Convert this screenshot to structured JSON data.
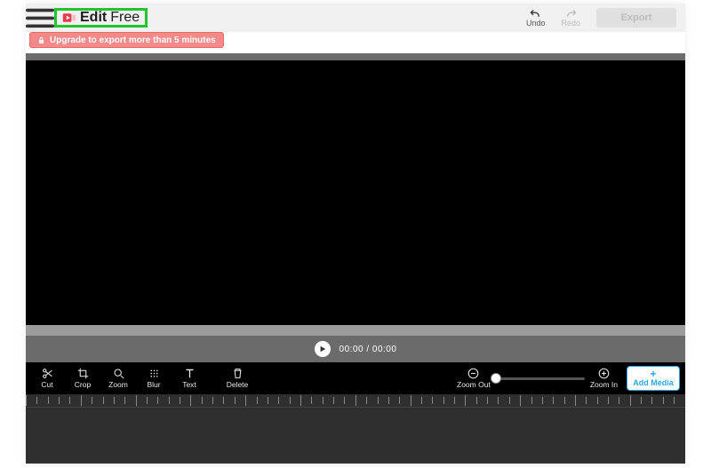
{
  "header": {
    "logo_a": "Edit",
    "logo_b": "Free",
    "undo_label": "Undo",
    "redo_label": "Redo",
    "export_label": "Export"
  },
  "banner": {
    "upgrade_text": "Upgrade to export more than 5 minutes"
  },
  "player": {
    "timecode": "00:00 / 00:00"
  },
  "tools": {
    "cut": "Cut",
    "crop": "Crop",
    "zoom": "Zoom",
    "blur": "Blur",
    "text": "Text",
    "delete": "Delete"
  },
  "zoom": {
    "out_label": "Zoom Out",
    "in_label": "Zoom In",
    "value_pct": 0
  },
  "add_media_label": "Add Media"
}
